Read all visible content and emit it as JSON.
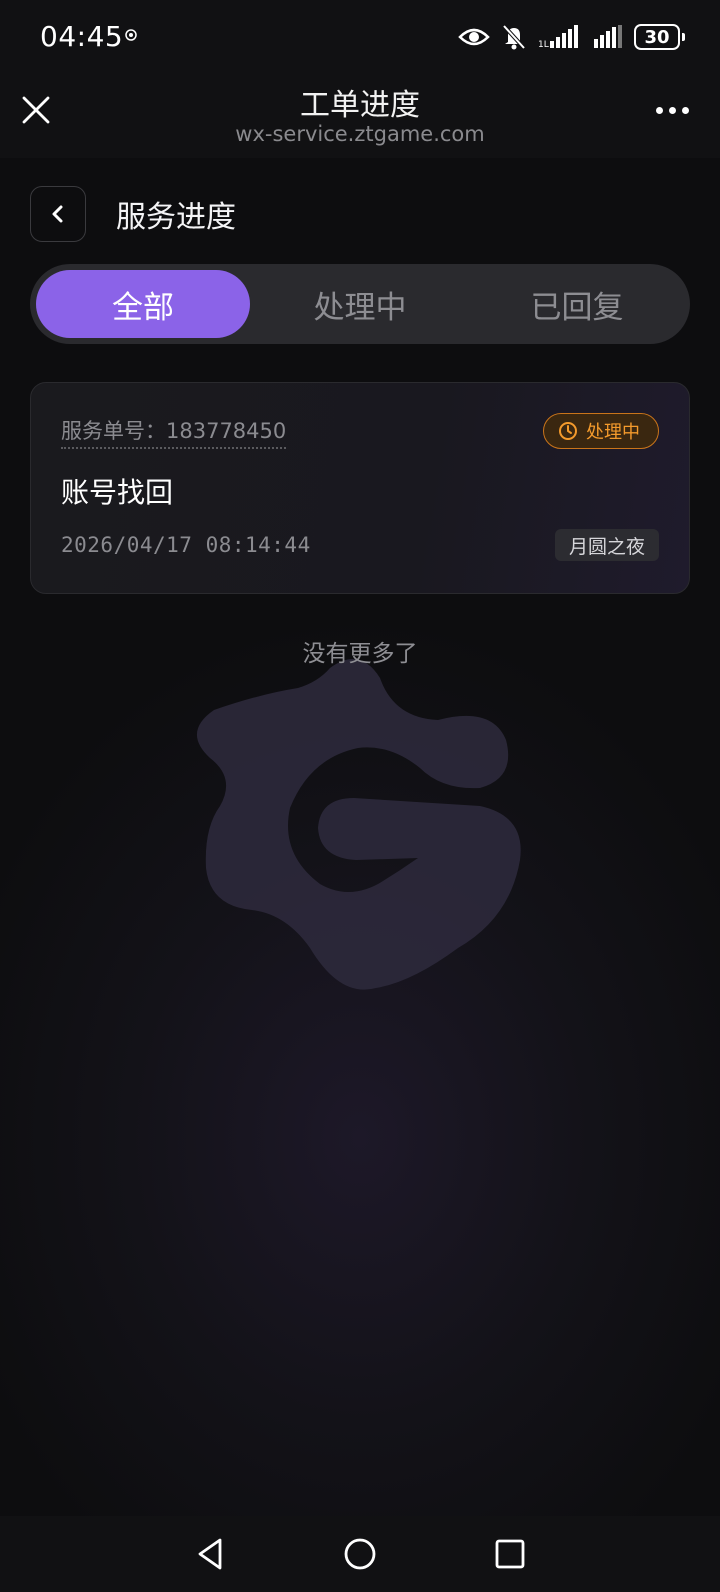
{
  "status_bar": {
    "time": "04:45",
    "battery": "30",
    "icons": [
      "location-dot-icon",
      "eye-icon",
      "mute-bell-icon",
      "signal-1-icon",
      "signal-2-icon",
      "battery-icon"
    ]
  },
  "title_bar": {
    "title": "工单进度",
    "subtitle": "wx-service.ztgame.com"
  },
  "page": {
    "title": "服务进度"
  },
  "tabs": [
    {
      "label": "全部",
      "active": true
    },
    {
      "label": "处理中",
      "active": false
    },
    {
      "label": "已回复",
      "active": false
    }
  ],
  "ticket": {
    "id_text": "服务单号：183778450",
    "status": "处理中",
    "title": "账号找回",
    "time": "2026/04/17 08:14:44",
    "server": "月圆之夜"
  },
  "list_end_text": "没有更多了",
  "colors": {
    "accent": "#8b63e8",
    "status_orange": "#f39a2c",
    "background": "#0d0d0f"
  }
}
